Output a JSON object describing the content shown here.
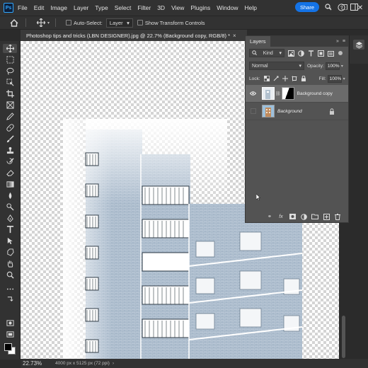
{
  "app": {
    "logo": "Ps",
    "menu": [
      "File",
      "Edit",
      "Image",
      "Layer",
      "Type",
      "Select",
      "Filter",
      "3D",
      "View",
      "Plugins",
      "Window",
      "Help"
    ]
  },
  "options_bar": {
    "auto_select_label": "Auto-Select:",
    "auto_select_value": "Layer",
    "transform_label": "Show Transform Controls",
    "more": "···",
    "share_label": "Share"
  },
  "document": {
    "tab_title": "Photoshop tips and tricks (LBN DESIGNER).jpg @ 22.7% (Background copy, RGB/8) *",
    "close": "×"
  },
  "status": {
    "zoom": "22.73%",
    "doc_info": "4000 px x 5125 px (72 ppi)",
    "arrow": "›"
  },
  "layers_panel": {
    "title": "Layers",
    "filter_kind": "Kind",
    "blend_mode": "Normal",
    "opacity_label": "Opacity:",
    "opacity_value": "100%",
    "lock_label": "Lock:",
    "fill_label": "Fill:",
    "fill_value": "100%",
    "layers": [
      {
        "name": "Background copy",
        "visible": true,
        "selected": true
      },
      {
        "name": "Background",
        "visible": false,
        "selected": false,
        "locked": true
      }
    ],
    "footer_icons": [
      "link-icon",
      "fx-icon",
      "mask-icon",
      "adjustment-icon",
      "group-icon",
      "new-layer-icon",
      "trash-icon"
    ]
  },
  "colors": {
    "accent": "#1473e6",
    "panel_bg": "#535353",
    "app_bg": "#2b2b2b"
  }
}
